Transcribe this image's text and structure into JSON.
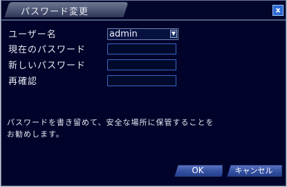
{
  "dialog": {
    "title": "パスワード変更",
    "close_label": "x"
  },
  "form": {
    "username_label": "ユーザー名",
    "username_value": "admin",
    "current_password_label": "現在のパスワード",
    "new_password_label": "新しいパスワード",
    "confirm_label": "再確認"
  },
  "note": {
    "line1": "パスワードを書き留めて、安全な場所に保管することを",
    "line2": "お勧めします。"
  },
  "buttons": {
    "ok": "OK",
    "cancel": "キャンセル"
  },
  "colors": {
    "background": "#01032a",
    "accent": "#3a67c7"
  }
}
